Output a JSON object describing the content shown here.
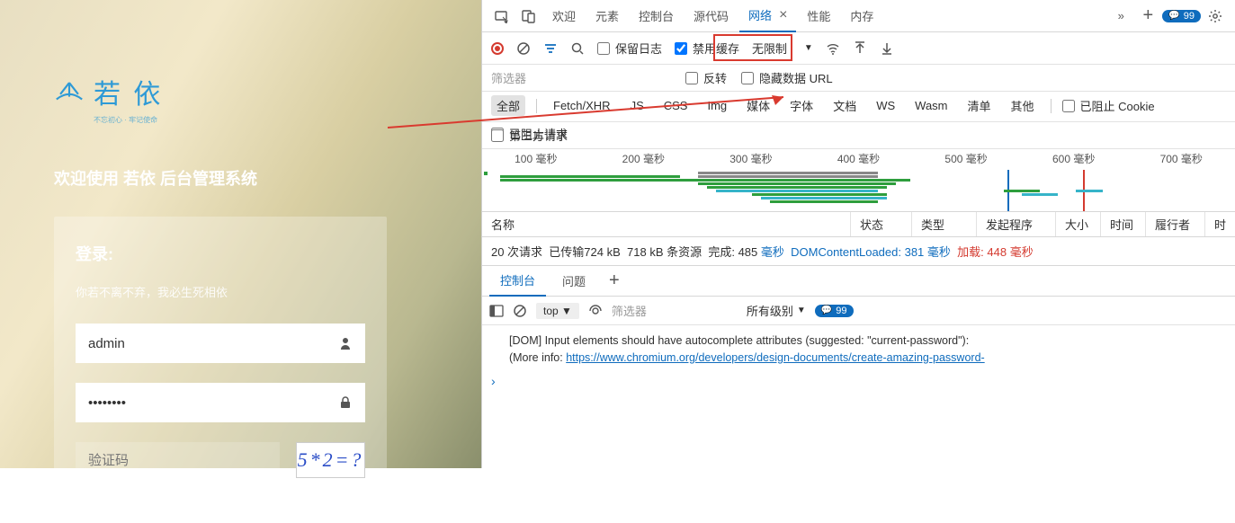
{
  "login": {
    "brand": "若 依",
    "brand_sub": "不忘初心 · 牢记使命",
    "welcome": "欢迎使用 若依 后台管理系统",
    "title": "登录:",
    "tip": "你若不离不弃，我必生死相依",
    "username": "admin",
    "password": "••••••••",
    "captcha_ph": "验证码",
    "captcha_img": "5*2=?"
  },
  "devtools": {
    "tabs": {
      "welcome": "欢迎",
      "elements": "元素",
      "console": "控制台",
      "sources": "源代码",
      "network": "网络",
      "performance": "性能",
      "memory": "内存"
    },
    "issues_count": "99",
    "toolbar": {
      "preserve": "保留日志",
      "disable_cache": "禁用缓存",
      "throttle": "无限制"
    },
    "filter_ph": "筛选器",
    "invert": "反转",
    "hide_data": "隐藏数据 URL",
    "types": {
      "all": "全部",
      "fetch": "Fetch/XHR",
      "js": "JS",
      "css": "CSS",
      "img": "Img",
      "media": "媒体",
      "font": "字体",
      "doc": "文档",
      "ws": "WS",
      "wasm": "Wasm",
      "manifest": "清单",
      "other": "其他",
      "blocked_cookie": "已阻止 Cookie",
      "blocked_req": "已阻止请求"
    },
    "third_party": "第三方请求",
    "timeline": [
      "100 毫秒",
      "200 毫秒",
      "300 毫秒",
      "400 毫秒",
      "500 毫秒",
      "600 毫秒",
      "700 毫秒"
    ],
    "headers": {
      "name": "名称",
      "status": "状态",
      "type": "类型",
      "initiator": "发起程序",
      "size": "大小",
      "time": "时间",
      "waterfall": "履行者",
      "t2": "时"
    },
    "status": {
      "a": "20 次请求",
      "b": "已传输724 kB",
      "c": "718 kB 条资源",
      "d": "完成: 485 ",
      "e": "毫秒",
      "f": "DOMContentLoaded: 381 ",
      "g": "毫秒",
      "h": "加载: 448 ",
      "i": "毫秒"
    },
    "console_tabs": {
      "console": "控制台",
      "issues": "问题"
    },
    "con_top": "top",
    "con_filter_ph": "筛选器",
    "con_levels": "所有级别",
    "con_badge": "99",
    "msg_line1": "[DOM] Input elements should have autocomplete attributes (suggested: \"current-password\"):",
    "msg_line2_a": "(More info: ",
    "msg_link": "https://www.chromium.org/developers/design-documents/create-amazing-password-"
  }
}
